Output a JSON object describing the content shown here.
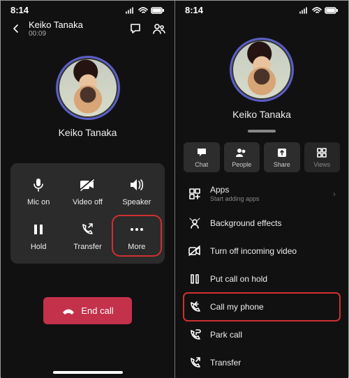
{
  "left": {
    "time": "8:14",
    "header": {
      "name": "Keiko Tanaka",
      "duration": "00:09"
    },
    "avatar_name": "Keiko Tanaka",
    "controls": {
      "mic": "Mic on",
      "video": "Video off",
      "speaker": "Speaker",
      "hold": "Hold",
      "transfer": "Transfer",
      "more": "More"
    },
    "end_call": "End call"
  },
  "right": {
    "time": "8:14",
    "avatar_name": "Keiko Tanaka",
    "mini": {
      "chat": "Chat",
      "people": "People",
      "share": "Share",
      "views": "Views"
    },
    "menu": {
      "apps": "Apps",
      "apps_sub": "Start adding apps",
      "bg": "Background effects",
      "off_video": "Turn off incoming video",
      "hold": "Put call on hold",
      "call_my_phone": "Call my phone",
      "park": "Park call",
      "transfer": "Transfer"
    }
  }
}
